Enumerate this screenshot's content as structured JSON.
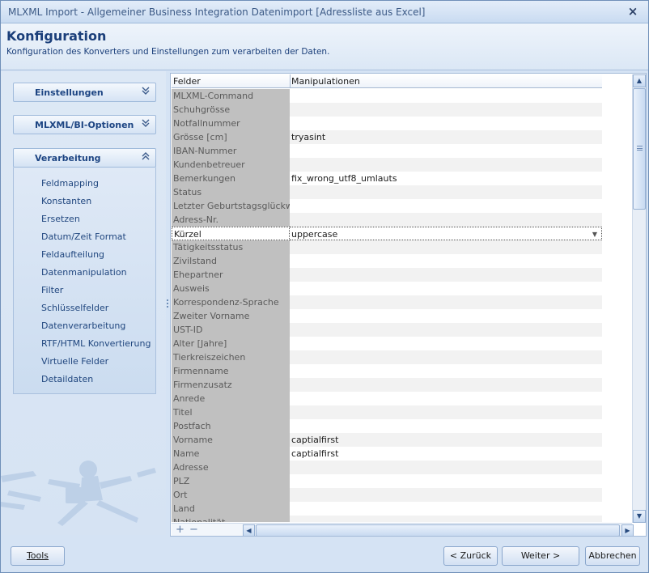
{
  "window": {
    "title": "MLXML Import - Allgemeiner Business Integration Datenimport [Adressliste aus Excel]",
    "close_glyph": "×"
  },
  "header": {
    "title": "Konfiguration",
    "subtitle": "Konfiguration des Konverters und Einstellungen zum verarbeiten der Daten."
  },
  "sidebar": {
    "groups": [
      {
        "label": "Einstellungen",
        "expanded": false,
        "icon": "chevron-double-down"
      },
      {
        "label": "MLXML/BI-Optionen",
        "expanded": false,
        "icon": "chevron-double-down"
      },
      {
        "label": "Verarbeitung",
        "expanded": true,
        "icon": "chevron-double-up"
      }
    ],
    "items": [
      {
        "label": "Feldmapping"
      },
      {
        "label": "Konstanten"
      },
      {
        "label": "Ersetzen"
      },
      {
        "label": "Datum/Zeit Format"
      },
      {
        "label": "Feldaufteilung"
      },
      {
        "label": "Datenmanipulation"
      },
      {
        "label": "Filter"
      },
      {
        "label": "Schlüsselfelder"
      },
      {
        "label": "Datenverarbeitung"
      },
      {
        "label": "RTF/HTML Konvertierung"
      },
      {
        "label": "Virtuelle Felder"
      },
      {
        "label": "Detaildaten"
      }
    ]
  },
  "grid": {
    "columns": [
      "Felder",
      "Manipulationen"
    ],
    "rows": [
      {
        "field": "MLXML-Command",
        "value": ""
      },
      {
        "field": "Schuhgrösse",
        "value": ""
      },
      {
        "field": "Notfallnummer",
        "value": ""
      },
      {
        "field": "Grösse [cm]",
        "value": "tryasint"
      },
      {
        "field": "IBAN-Nummer",
        "value": ""
      },
      {
        "field": "Kundenbetreuer",
        "value": ""
      },
      {
        "field": "Bemerkungen",
        "value": "fix_wrong_utf8_umlauts"
      },
      {
        "field": "Status",
        "value": ""
      },
      {
        "field": "Letzter Geburtstagsglückwunsch",
        "value": ""
      },
      {
        "field": "Adress-Nr.",
        "value": ""
      },
      {
        "field": "Kürzel",
        "value": "uppercase",
        "selected": true
      },
      {
        "field": "Tätigkeitsstatus",
        "value": ""
      },
      {
        "field": "Zivilstand",
        "value": ""
      },
      {
        "field": "Ehepartner",
        "value": ""
      },
      {
        "field": "Ausweis",
        "value": ""
      },
      {
        "field": "Korrespondenz-Sprache",
        "value": ""
      },
      {
        "field": "Zweiter Vorname",
        "value": ""
      },
      {
        "field": "UST-ID",
        "value": ""
      },
      {
        "field": "Alter [Jahre]",
        "value": ""
      },
      {
        "field": "Tierkreiszeichen",
        "value": ""
      },
      {
        "field": "Firmenname",
        "value": ""
      },
      {
        "field": "Firmenzusatz",
        "value": ""
      },
      {
        "field": "Anrede",
        "value": ""
      },
      {
        "field": "Titel",
        "value": ""
      },
      {
        "field": "Postfach",
        "value": ""
      },
      {
        "field": "Vorname",
        "value": "captialfirst"
      },
      {
        "field": "Name",
        "value": "captialfirst"
      },
      {
        "field": "Adresse",
        "value": ""
      },
      {
        "field": "PLZ",
        "value": ""
      },
      {
        "field": "Ort",
        "value": ""
      },
      {
        "field": "Land",
        "value": ""
      },
      {
        "field": "Nationalität",
        "value": ""
      }
    ],
    "add_glyph": "+",
    "remove_glyph": "−"
  },
  "footer": {
    "tools_label": "Tools",
    "back_label": "< Zurück",
    "next_label": "Weiter >",
    "cancel_label": "Abbrechen"
  },
  "colors": {
    "header_title": "#1b3f7a",
    "field_column_bg": "#c0c0c0",
    "panel_bg": "#d5e3f4"
  }
}
